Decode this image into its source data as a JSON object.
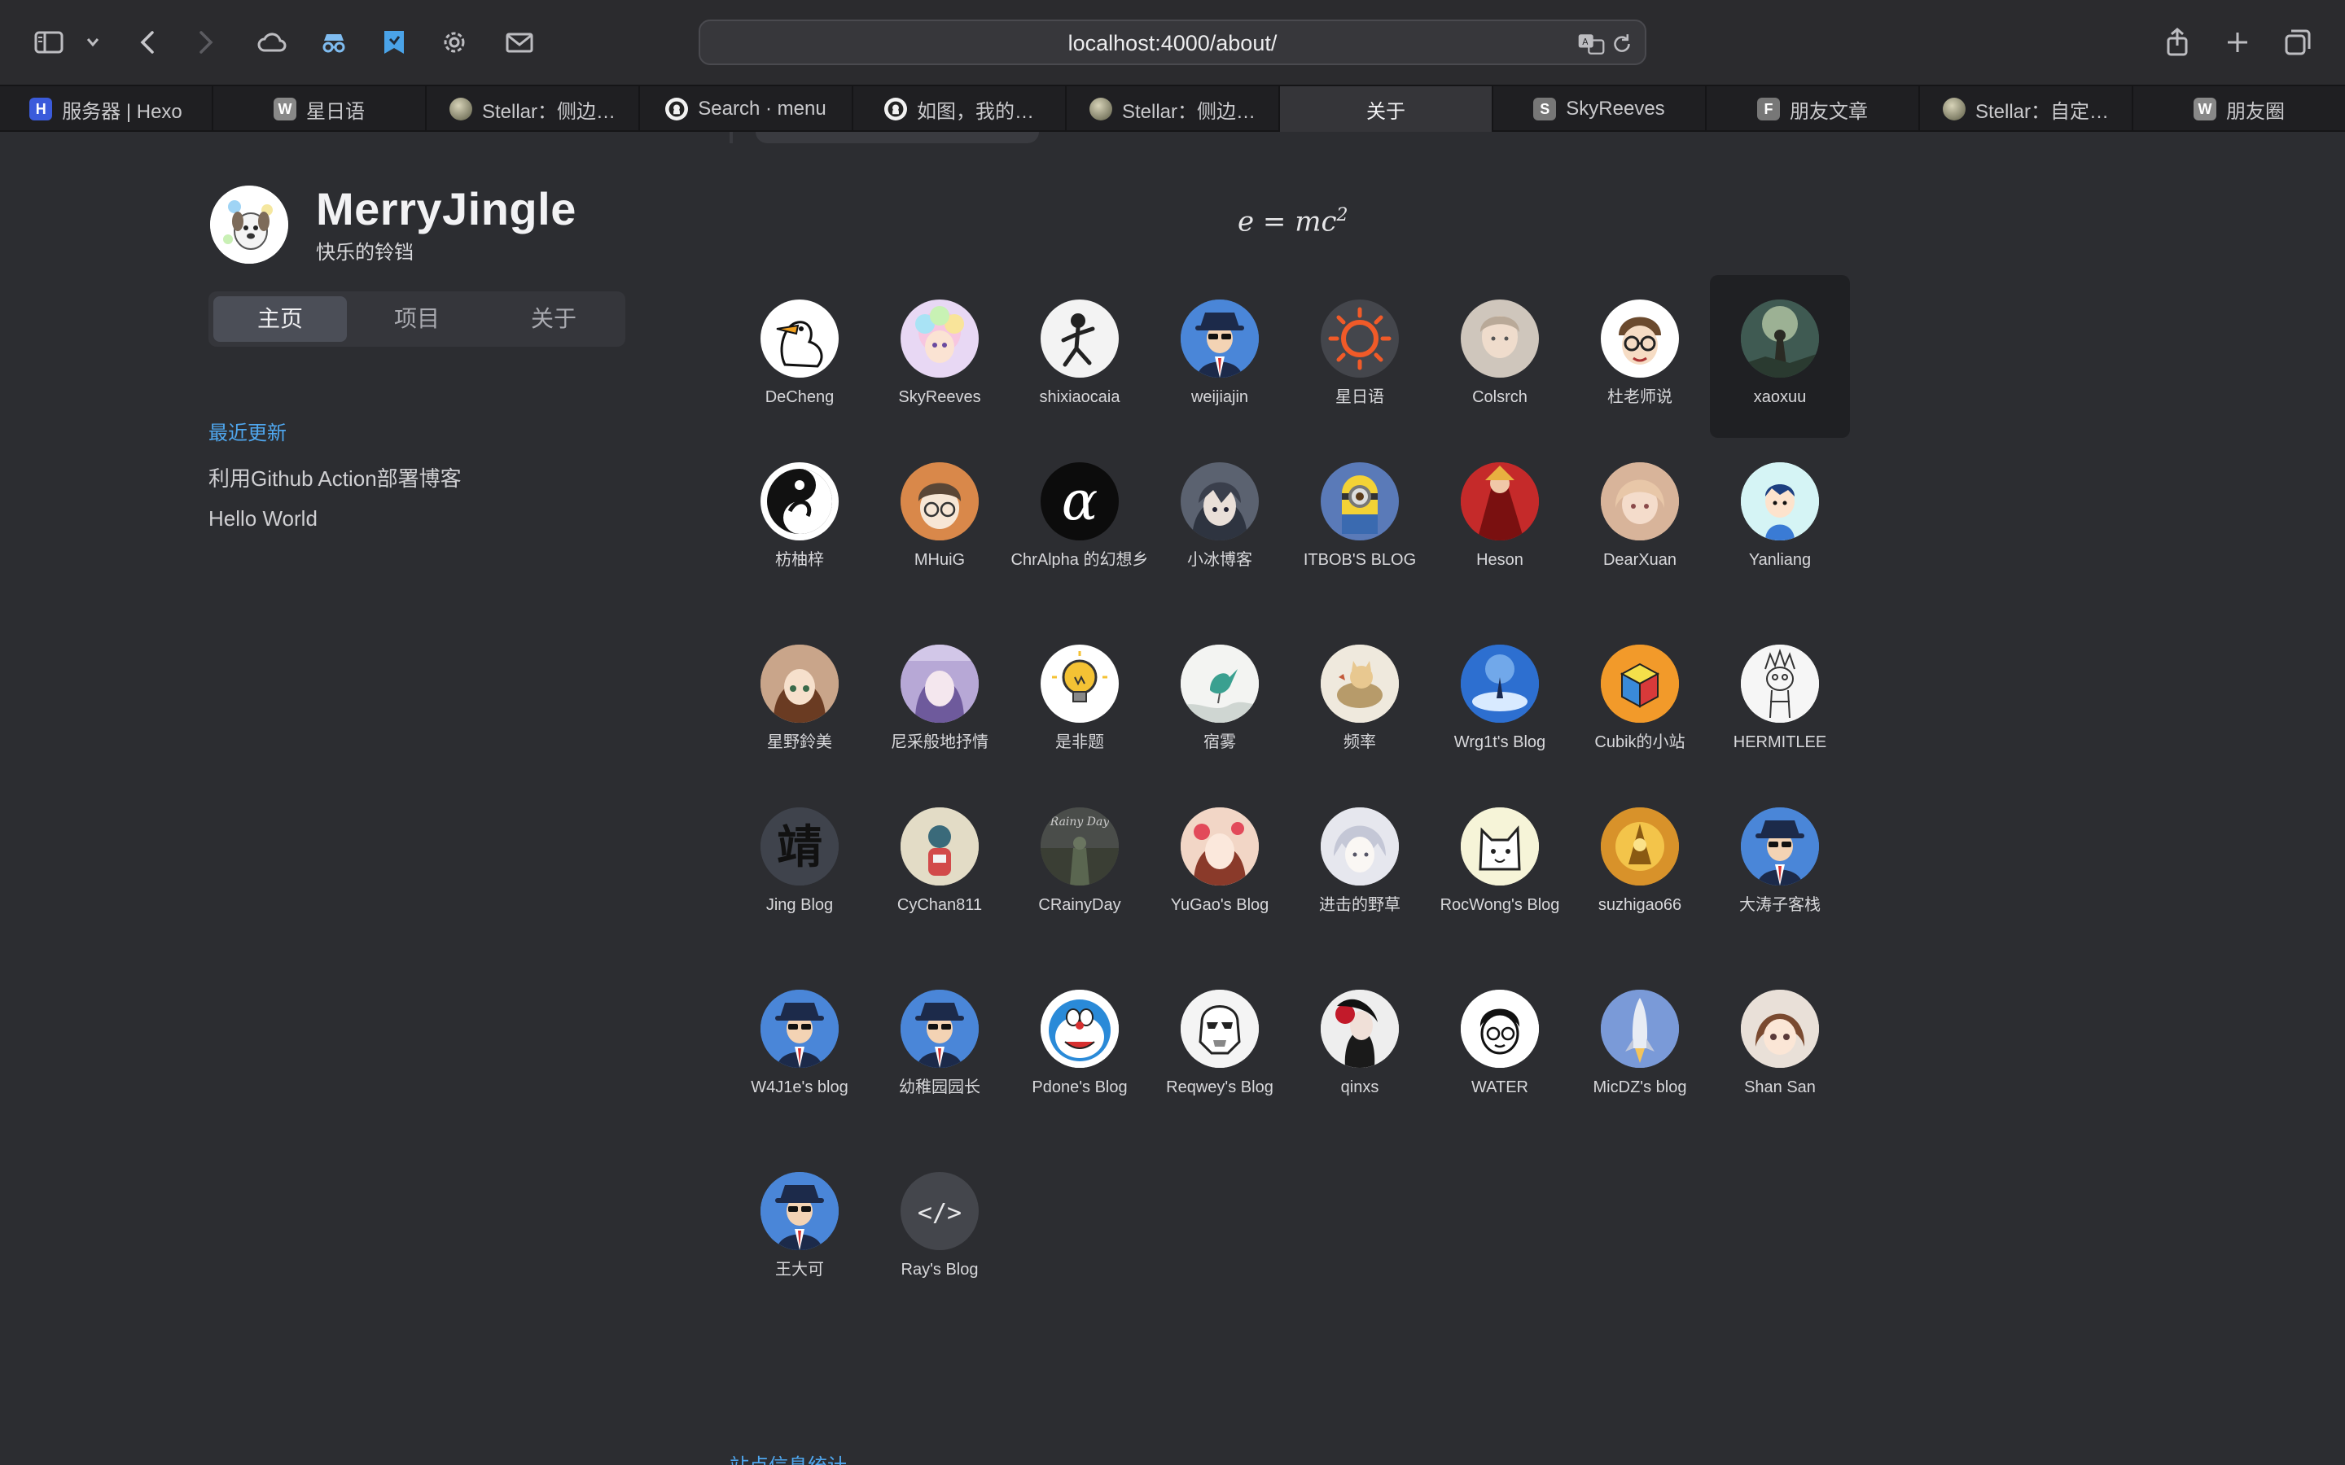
{
  "browser": {
    "url": "localhost:4000/about/",
    "tabs": [
      {
        "label": "服务器 | Hexo",
        "fav": "H",
        "color": "#3b5bdb"
      },
      {
        "label": "星日语",
        "fav": "W",
        "color": "#888888"
      },
      {
        "label": "Stellar：侧边…",
        "fav": "",
        "color": "#6b6b4a"
      },
      {
        "label": "Search · menu",
        "fav": "",
        "color": "#ffffff"
      },
      {
        "label": "如图，我的…",
        "fav": "",
        "color": "#ffffff"
      },
      {
        "label": "Stellar：侧边…",
        "fav": "",
        "color": "#6b6b4a"
      },
      {
        "label": "关于",
        "fav": "",
        "color": "#353539"
      },
      {
        "label": "SkyReeves",
        "fav": "S",
        "color": "#777777"
      },
      {
        "label": "朋友文章",
        "fav": "F",
        "color": "#777777"
      },
      {
        "label": "Stellar：自定…",
        "fav": "",
        "color": "#6b6b4a"
      },
      {
        "label": "朋友圈",
        "fav": "W",
        "color": "#888888"
      }
    ],
    "toolbar_icons": [
      "sidebar-icon",
      "chevron-down-icon",
      "back-icon",
      "forward-icon",
      "cloud-icon",
      "spy-icon",
      "bookmark-shield-icon",
      "gear-icon",
      "mail-icon",
      "translate-icon",
      "reload-icon",
      "share-icon",
      "new-tab-icon",
      "tab-overview-icon"
    ]
  },
  "site": {
    "title": "MerryJingle",
    "subtitle": "快乐的铃铛",
    "nav": [
      "主页",
      "项目",
      "关于"
    ],
    "recent_heading": "最近更新",
    "recent_posts": [
      "利用Github Action部署博客",
      "Hello World"
    ]
  },
  "formula": {
    "base": "e = mc",
    "exp": "2"
  },
  "friends": [
    {
      "name": "DeCheng",
      "style": "duck"
    },
    {
      "name": "SkyReeves",
      "style": "rainbow"
    },
    {
      "name": "shixiaocaia",
      "style": "stick"
    },
    {
      "name": "weijiajin",
      "style": "agent"
    },
    {
      "name": "星日语",
      "style": "sun"
    },
    {
      "name": "Colsrch",
      "style": "portrait"
    },
    {
      "name": "杜老师说",
      "style": "glasses"
    },
    {
      "name": "xaoxuu",
      "style": "scene",
      "highlighted": true
    },
    {
      "name": "枋柚梓",
      "style": "yinyang"
    },
    {
      "name": "MHuiG",
      "style": "anime"
    },
    {
      "name": "ChrAlpha 的幻想乡",
      "style": "alpha"
    },
    {
      "name": "小冰博客",
      "style": "darkanime"
    },
    {
      "name": "ITBOB'S BLOG",
      "style": "minion"
    },
    {
      "name": "Heson",
      "style": "red"
    },
    {
      "name": "DearXuan",
      "style": "warm"
    },
    {
      "name": "Yanliang",
      "style": "cartoon"
    },
    {
      "name": "星野鈴美",
      "style": "girl"
    },
    {
      "name": "尼采般地抒情",
      "style": "lilac"
    },
    {
      "name": "是非题",
      "style": "bulb"
    },
    {
      "name": "宿雾",
      "style": "bird"
    },
    {
      "name": "频率",
      "style": "cat"
    },
    {
      "name": "Wrg1t's Blog",
      "style": "sky"
    },
    {
      "name": "Cubik的小站",
      "style": "cube"
    },
    {
      "name": "HERMITLEE",
      "style": "sketch"
    },
    {
      "name": "Jing Blog",
      "style": "calli"
    },
    {
      "name": "CyChan811",
      "style": "tan"
    },
    {
      "name": "CRainyDay",
      "style": "rainy"
    },
    {
      "name": "YuGao's Blog",
      "style": "flower"
    },
    {
      "name": "进击的野草",
      "style": "pale"
    },
    {
      "name": "RocWong's Blog",
      "style": "catline"
    },
    {
      "name": "suzhigao66",
      "style": "gold"
    },
    {
      "name": "大涛子客栈",
      "style": "agent"
    },
    {
      "name": "W4J1e's blog",
      "style": "agent"
    },
    {
      "name": "幼稚园园长",
      "style": "agent"
    },
    {
      "name": "Pdone's Blog",
      "style": "doraemon"
    },
    {
      "name": "Reqwey's Blog",
      "style": "trooper"
    },
    {
      "name": "qinxs",
      "style": "rose"
    },
    {
      "name": "WATER",
      "style": "boy"
    },
    {
      "name": "MicDZ's blog",
      "style": "rocket"
    },
    {
      "name": "Shan San",
      "style": "brownhair"
    },
    {
      "name": "王大可",
      "style": "agent"
    },
    {
      "name": "Ray's Blog",
      "style": "code"
    }
  ],
  "bottom_link": "站点信息统计"
}
